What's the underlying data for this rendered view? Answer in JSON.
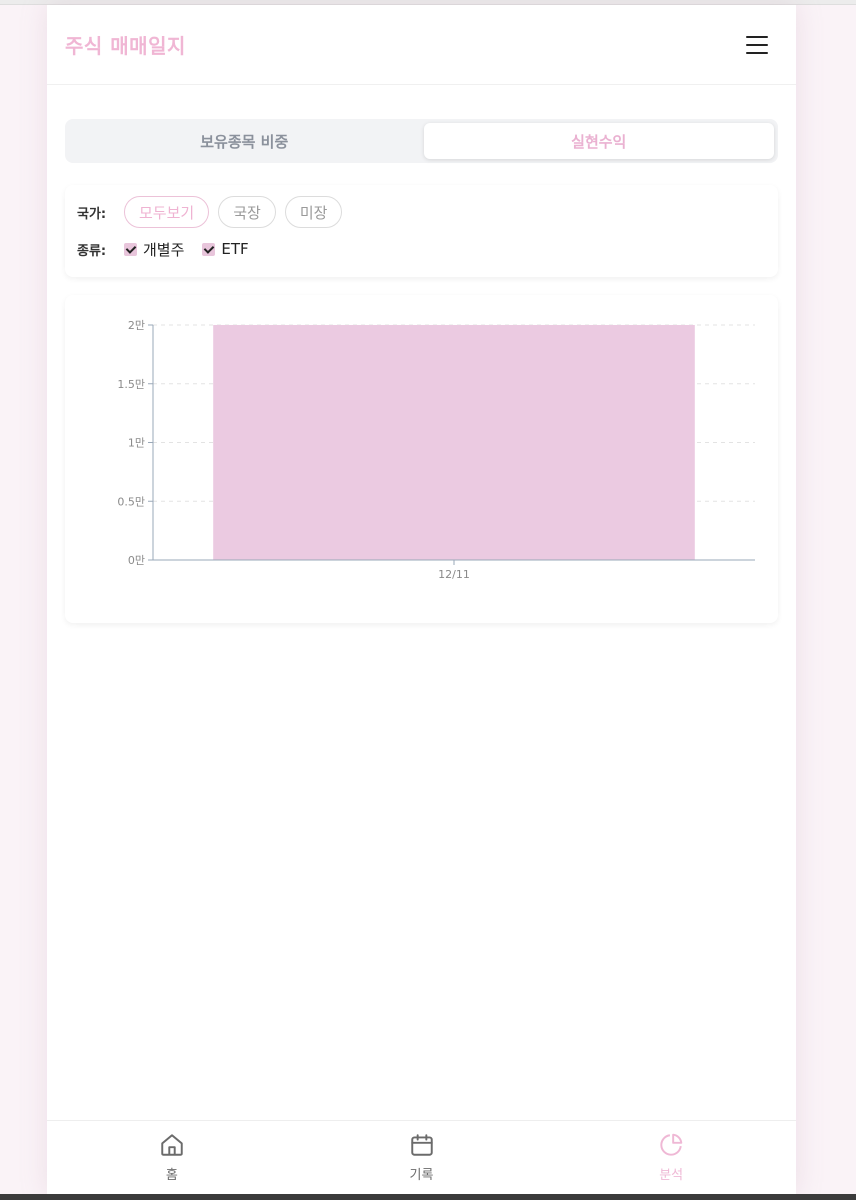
{
  "header": {
    "title": "주식 매매일지",
    "menu_icon": "hamburger-menu-icon"
  },
  "tabs": [
    {
      "label": "보유종목 비중",
      "active": false
    },
    {
      "label": "실현수익",
      "active": true
    }
  ],
  "filters": {
    "country_label": "국가:",
    "country_options": [
      {
        "label": "모두보기",
        "selected": true
      },
      {
        "label": "국장",
        "selected": false
      },
      {
        "label": "미장",
        "selected": false
      }
    ],
    "type_label": "종류:",
    "type_options": [
      {
        "label": "개별주",
        "checked": true
      },
      {
        "label": "ETF",
        "checked": true
      }
    ]
  },
  "chart_data": {
    "type": "bar",
    "categories": [
      "12/11"
    ],
    "values": [
      20000
    ],
    "title": "",
    "xlabel": "",
    "ylabel": "",
    "ylim": [
      0,
      20000
    ],
    "yticks": [
      "0만",
      "0.5만",
      "1만",
      "1.5만",
      "2만"
    ],
    "grid": true,
    "bar_color": "#ebcae1"
  },
  "bottom_nav": [
    {
      "label": "홈",
      "icon": "home-icon",
      "active": false
    },
    {
      "label": "기록",
      "icon": "calendar-icon",
      "active": false
    },
    {
      "label": "분석",
      "icon": "pie-chart-icon",
      "active": true
    }
  ],
  "colors": {
    "accent": "#efb3d2",
    "bar": "#ebcae1"
  }
}
